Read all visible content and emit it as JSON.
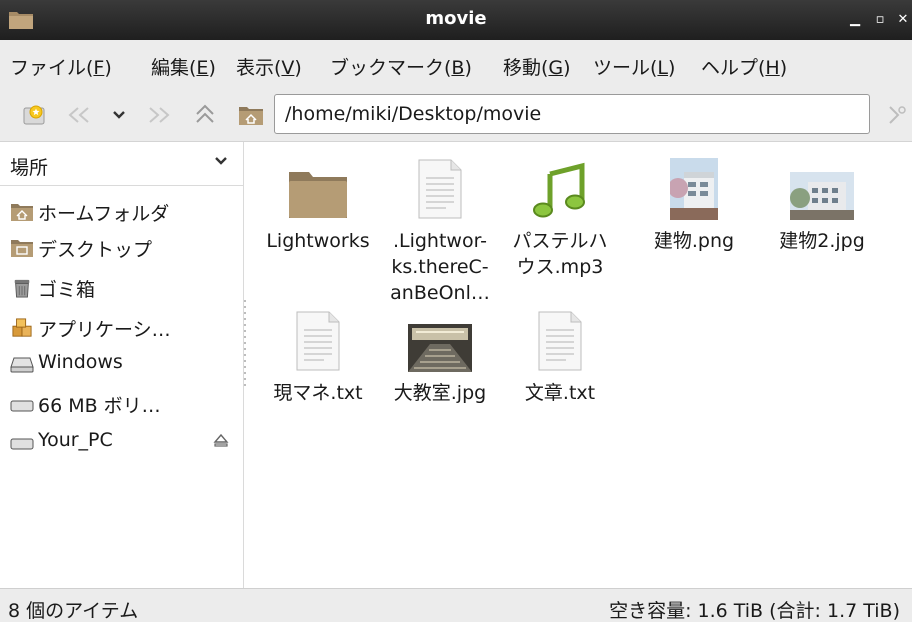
{
  "window": {
    "title": "movie"
  },
  "menu": [
    {
      "label": "ファイル(",
      "acc": "F",
      "tail": ")"
    },
    {
      "label": "編集(",
      "acc": "E",
      "tail": ")"
    },
    {
      "label": "表示(",
      "acc": "V",
      "tail": ")"
    },
    {
      "label": "ブックマーク(",
      "acc": "B",
      "tail": ")"
    },
    {
      "label": "移動(",
      "acc": "G",
      "tail": ")"
    },
    {
      "label": "ツール(",
      "acc": "L",
      "tail": ")"
    },
    {
      "label": "ヘルプ(",
      "acc": "H",
      "tail": ")"
    }
  ],
  "toolbar": {
    "path": "/home/miki/Desktop/movie"
  },
  "sidepane": {
    "header": "場所",
    "places": [
      {
        "label": "ホームフォルダ",
        "icon": "home-folder-icon"
      },
      {
        "label": "デスクトップ",
        "icon": "desktop-folder-icon"
      },
      {
        "label": "ゴミ箱",
        "icon": "trash-icon"
      },
      {
        "label": "アプリケーシ…",
        "icon": "applications-icon"
      },
      {
        "label": "Windows",
        "icon": "drive-icon"
      },
      {
        "label": "66 MB ボリ…",
        "icon": "volume-icon"
      },
      {
        "label": "Your_PC",
        "icon": "drive-icon"
      }
    ]
  },
  "files": [
    {
      "name": "Lightworks",
      "type": "folder"
    },
    {
      "name": ".Lightwor-\nks.thereC-\nanBeOnl…",
      "type": "text"
    },
    {
      "name": "パステルハ\nウス.mp3",
      "type": "audio"
    },
    {
      "name": "建物.png",
      "type": "image-building"
    },
    {
      "name": "建物2.jpg",
      "type": "image-building2"
    },
    {
      "name": "現マネ.txt",
      "type": "text"
    },
    {
      "name": "大教室.jpg",
      "type": "image-classroom"
    },
    {
      "name": "文章.txt",
      "type": "text"
    }
  ],
  "status": {
    "items": "8 個のアイテム",
    "free": "空き容量: 1.6 TiB (合計: 1.7 TiB)"
  }
}
